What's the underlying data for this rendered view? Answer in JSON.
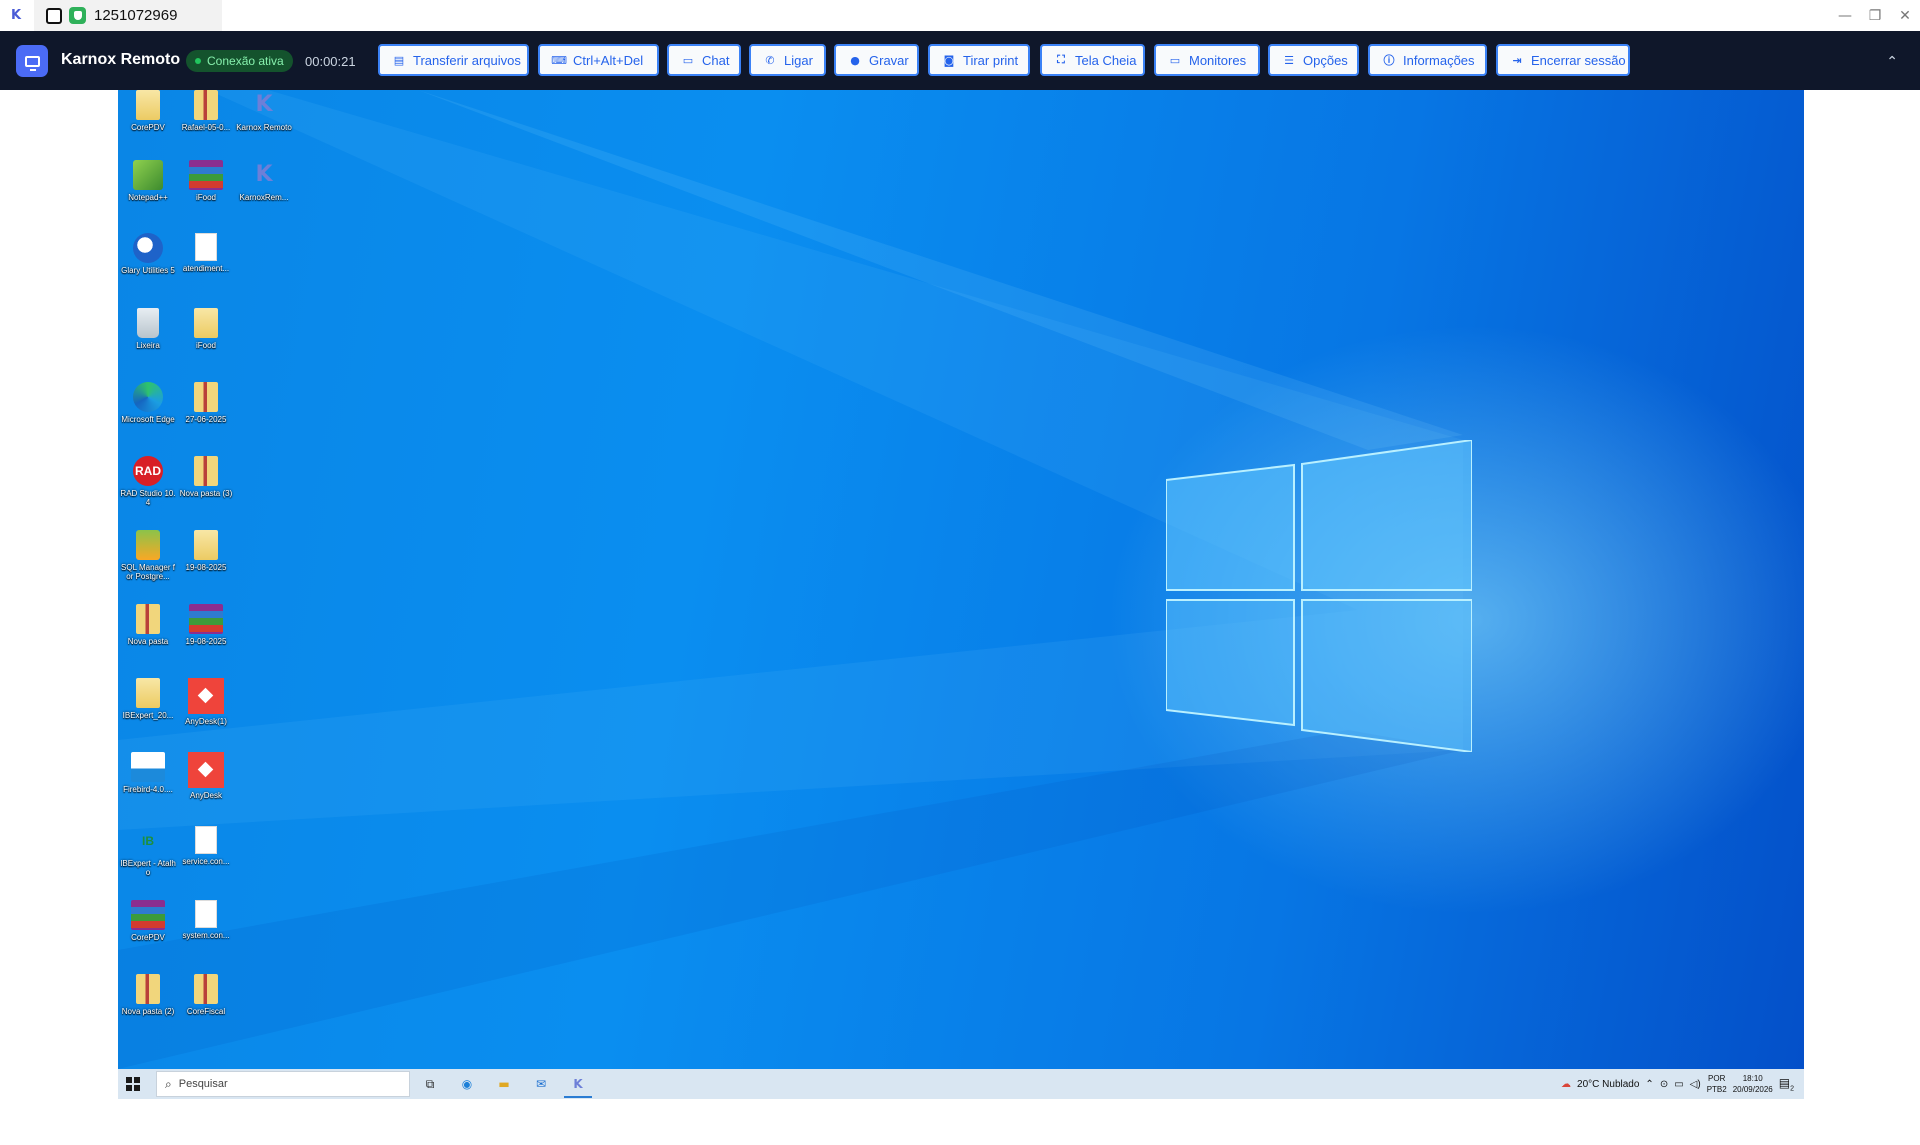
{
  "window": {
    "session_id": "1251072969",
    "controls": [
      "—",
      "❐",
      "✕"
    ]
  },
  "toolbar": {
    "brand": "Karnox Remoto",
    "status": "Conexão ativa",
    "timer": "00:00:21",
    "buttons": [
      {
        "label": "Transferir arquivos",
        "icon": "file-upload-icon"
      },
      {
        "label": "Ctrl+Alt+Del",
        "icon": "keyboard-icon"
      },
      {
        "label": "Chat",
        "icon": "chat-icon"
      },
      {
        "label": "Ligar",
        "icon": "phone-icon"
      },
      {
        "label": "Gravar",
        "icon": "record-icon"
      },
      {
        "label": "Tirar print",
        "icon": "camera-icon"
      },
      {
        "label": "Tela Cheia",
        "icon": "fullscreen-icon"
      },
      {
        "label": "Monitores",
        "icon": "monitor-icon"
      },
      {
        "label": "Opções",
        "icon": "sliders-icon"
      },
      {
        "label": "Informações",
        "icon": "info-icon"
      },
      {
        "label": "Encerrar sessão",
        "icon": "logout-icon"
      }
    ],
    "colors": {
      "bar": "#0f172a",
      "accent": "#2563eb",
      "status_green": "#22c55e"
    }
  },
  "desktop": {
    "icons": [
      {
        "label": "CorePDV",
        "kind": "folder"
      },
      {
        "label": "Rafael-05-0...",
        "kind": "folder-zip"
      },
      {
        "label": "Karnox Remoto",
        "kind": "karnox"
      },
      {
        "label": "Notepad++",
        "kind": "notepad"
      },
      {
        "label": "iFood",
        "kind": "winrar"
      },
      {
        "label": "KarnoxRem...",
        "kind": "karnox"
      },
      {
        "label": "Glary Utilities 5",
        "kind": "glary"
      },
      {
        "label": "atendiment...",
        "kind": "doc"
      },
      {
        "label": "Lixeira",
        "kind": "trash"
      },
      {
        "label": "iFood",
        "kind": "folder"
      },
      {
        "label": "Microsoft Edge",
        "kind": "edge"
      },
      {
        "label": "27-06-2025",
        "kind": "folder-zip"
      },
      {
        "label": "RAD Studio 10.4",
        "kind": "rad"
      },
      {
        "label": "Nova pasta (3)",
        "kind": "folder-zip"
      },
      {
        "label": "SQL Manager for Postgre...",
        "kind": "sqlm"
      },
      {
        "label": "19-08-2025",
        "kind": "folder"
      },
      {
        "label": "Nova pasta",
        "kind": "folder-zip"
      },
      {
        "label": "19-08-2025",
        "kind": "winrar"
      },
      {
        "label": "IBExpert_20...",
        "kind": "folder"
      },
      {
        "label": "AnyDesk(1)",
        "kind": "anydesk"
      },
      {
        "label": "Firebird-4.0....",
        "kind": "firebird"
      },
      {
        "label": "AnyDesk",
        "kind": "anydesk"
      },
      {
        "label": "IBExpert - Atalho",
        "kind": "ibexpert"
      },
      {
        "label": "service.con...",
        "kind": "doc"
      },
      {
        "label": "CorePDV",
        "kind": "winrar"
      },
      {
        "label": "system.con...",
        "kind": "doc"
      },
      {
        "label": "Nova pasta (2)",
        "kind": "folder-zip"
      },
      {
        "label": "CoreFiscal",
        "kind": "folder-zip"
      }
    ]
  },
  "taskbar": {
    "search_placeholder": "Pesquisar",
    "weather": "20°C  Nublado",
    "lang1": "POR",
    "lang2": "PTB2",
    "time": "18:10",
    "date": "20/09/2026",
    "notifications": "2"
  }
}
